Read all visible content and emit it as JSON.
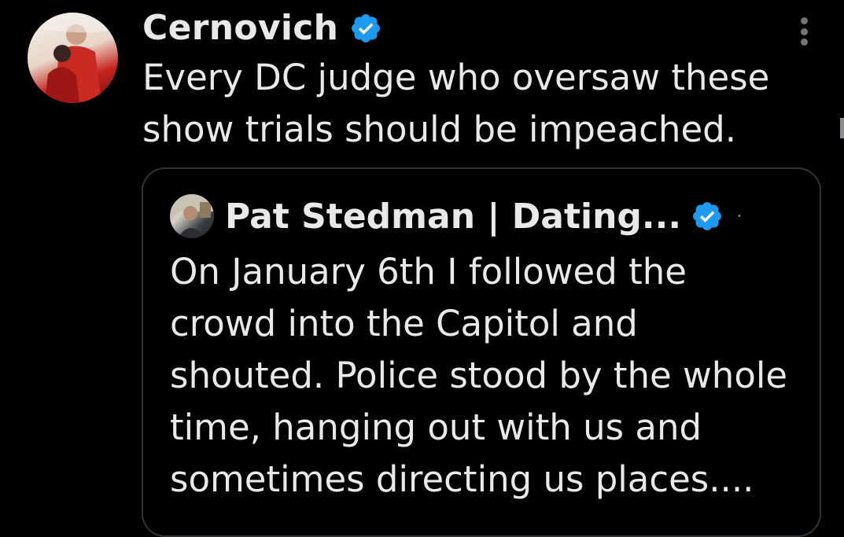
{
  "tweet": {
    "author": {
      "display_name": "Cernovich",
      "verified": true,
      "avatar_icon": "profile-photo"
    },
    "text_lines": [
      "Every DC judge who oversaw these",
      "show trials should be impeached."
    ],
    "more_icon": "more-vertical-icon"
  },
  "quote": {
    "author": {
      "display_name": "Pat Stedman | Dating...",
      "verified": true,
      "separator": "·",
      "avatar_icon": "profile-photo"
    },
    "text_lines": [
      "On January 6th I followed the",
      "crowd into the Capitol and",
      "shouted. Police stood by the whole",
      "time, hanging out with us and",
      "sometimes directing us places...."
    ]
  },
  "colors": {
    "background": "#000000",
    "text_primary": "#e7e9ea",
    "text_secondary": "#71767b",
    "border": "#2f3336",
    "verified_blue": "#1d9bf0"
  }
}
